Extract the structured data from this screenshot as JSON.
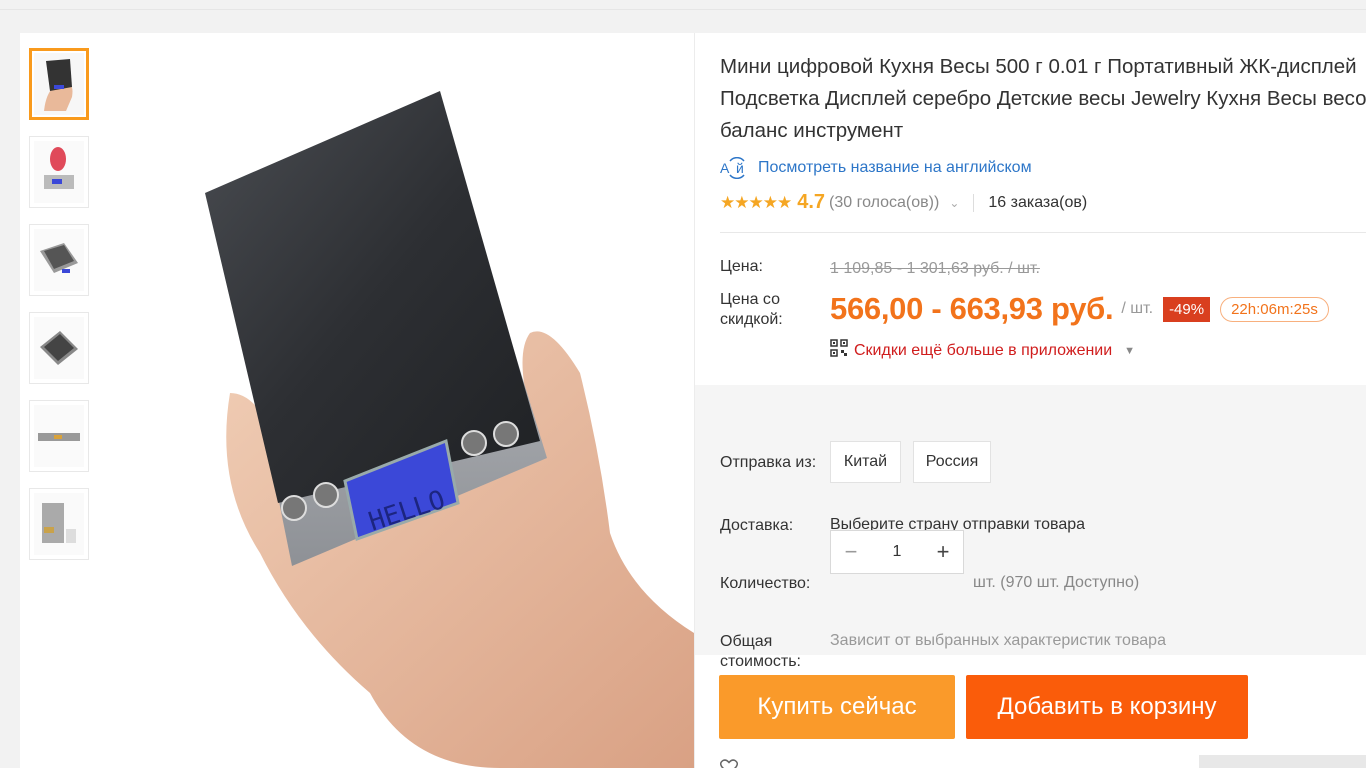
{
  "product": {
    "title_lines": [
      "Мини цифровой Кухня Весы 500 г 0.01 г Портативный ЖК-дисплей",
      "Подсветка Дисплей серебро Детские весы Jewelry Кухня Весы весовой",
      "баланс инструмент"
    ],
    "translate_link": "Посмотреть название на английском",
    "translate_icon_text": "A⃀й",
    "rating": {
      "stars": "★★★★★",
      "value": "4.7",
      "votes": "(30 голоса(ов))",
      "orders": "16 заказа(ов)"
    }
  },
  "pricing": {
    "price_label": "Цена:",
    "old_price": "1 109,85 - 1 301,63 руб. / шт.",
    "sale_label_line1": "Цена со",
    "sale_label_line2": "скидкой:",
    "sale_price": "566,00 - 663,93 руб.",
    "unit": "/ шт.",
    "discount": "-49%",
    "timer": "22h:06m:25s",
    "app_promo": "Скидки ещё больше в приложении"
  },
  "options": {
    "ship_from_label": "Отправка из:",
    "ship_from": [
      "Китай",
      "Россия"
    ],
    "delivery_label": "Доставка:",
    "delivery_value": "Выберите страну отправки товара",
    "quantity_label": "Количество:",
    "quantity_value": "1",
    "quantity_minus": "−",
    "quantity_plus": "+",
    "quantity_available": "шт. (970 шт. Доступно)",
    "total_label_line1": "Общая",
    "total_label_line2": "стоимость:",
    "total_value": "Зависит от выбранных характеристик товара"
  },
  "actions": {
    "buy_now": "Купить сейчас",
    "add_to_cart": "Добавить в корзину"
  },
  "display_text": "HELLO",
  "colors": {
    "accent_orange": "#f2731b",
    "buy_button": "#fa9a2a",
    "cart_button": "#fa5c0a",
    "discount_badge": "#d93f1f",
    "link_blue": "#2d76c8",
    "promo_red": "#d01d1d",
    "star": "#f5a623"
  }
}
